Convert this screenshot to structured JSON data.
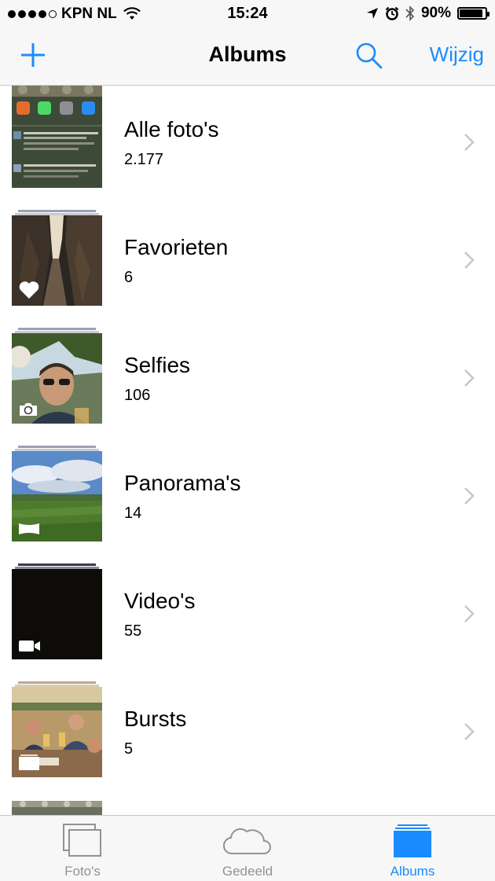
{
  "status_bar": {
    "carrier": "KPN NL",
    "time": "15:24",
    "battery": "90%",
    "battery_level": 0.9
  },
  "nav": {
    "title": "Albums",
    "edit_label": "Wijzig"
  },
  "albums": [
    {
      "name": "Alle foto's",
      "count": "2.177",
      "badge_icon": ""
    },
    {
      "name": "Favorieten",
      "count": "6",
      "badge_icon": "heart-icon"
    },
    {
      "name": "Selfies",
      "count": "106",
      "badge_icon": "selfie-camera-icon"
    },
    {
      "name": "Panorama's",
      "count": "14",
      "badge_icon": "panorama-icon"
    },
    {
      "name": "Video's",
      "count": "55",
      "badge_icon": "video-camera-icon"
    },
    {
      "name": "Bursts",
      "count": "5",
      "badge_icon": "burst-icon"
    }
  ],
  "tabs": [
    {
      "label": "Foto's",
      "icon": "photos-icon",
      "active": false
    },
    {
      "label": "Gedeeld",
      "icon": "cloud-icon",
      "active": false
    },
    {
      "label": "Albums",
      "icon": "albums-icon",
      "active": true
    }
  ],
  "colors": {
    "accent": "#1a8cff",
    "bar_background": "#f7f7f7",
    "inactive_tab": "#929292",
    "chevron": "#c7c7cc"
  }
}
